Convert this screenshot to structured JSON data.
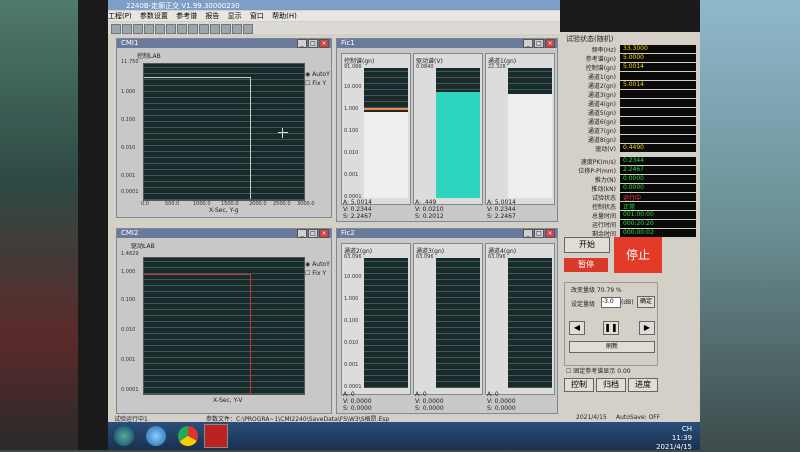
{
  "app": {
    "title": "2240B-走廊正交 V1.99.30000230"
  },
  "menu": [
    "工程(P)",
    "参数设置",
    "参考谱",
    "报告",
    "显示",
    "窗口",
    "帮助(H)"
  ],
  "cmi1": {
    "title": "CMI1",
    "plot_title": "控制LAB",
    "y_top": "11.750",
    "y_ticks": [
      "1.000",
      "0.100",
      "0.010",
      "0.001",
      "0.0001"
    ],
    "x_ticks": [
      "0.0",
      "500.0",
      "1000.0",
      "1500.0",
      "2000.0",
      "2500.0",
      "3000.0"
    ],
    "xlabel": "X-Sec, Y-g",
    "auto": "AutoY",
    "fix": "Fix Y"
  },
  "cmi2": {
    "title": "CMI2",
    "plot_title": "驱动LAB",
    "y_top": "1.4829",
    "y_ticks": [
      "1.000",
      "0.100",
      "0.010",
      "0.001",
      "0.0001"
    ],
    "x_ticks": [
      "0.0",
      "500.0",
      "1000.0",
      "1500.0",
      "2000.0",
      "2500.0",
      "3000.0"
    ],
    "xlabel": "X-Sec, Y-V",
    "auto": "AutoY",
    "fix": "Fix Y"
  },
  "fic1": {
    "title": "Fic1",
    "panels": [
      {
        "label": "控制谱(gn)",
        "top": "91.086",
        "ticks": [
          "10.000",
          "1.000",
          "0.100",
          "0.010",
          "0.001",
          "0.0001"
        ],
        "readout": [
          "A: 5.0014",
          "V: 0.2344",
          "S: 2.2467"
        ]
      },
      {
        "label": "驱动谱(V)",
        "top": "0.0840",
        "ticks": [
          "",
          "",
          "",
          "",
          "",
          ""
        ],
        "readout": [
          "A: .449",
          "V: 0.0210",
          "S: 0.2012"
        ]
      },
      {
        "label": "通道1(gn)",
        "top": "22.328",
        "ticks": [
          "",
          "",
          "",
          "",
          "",
          ""
        ],
        "readout": [
          "A: 5.0014",
          "V: 0.2344",
          "S: 2.2467"
        ]
      }
    ]
  },
  "fic2": {
    "title": "Fic2",
    "panels": [
      {
        "label": "通道2(gn)",
        "top": "63.096",
        "ticks": [
          "10.000",
          "1.000",
          "0.100",
          "0.010",
          "0.001",
          "0.0001"
        ],
        "readout": [
          "A: 0",
          "V: 0.0000",
          "S: 0.0000"
        ]
      },
      {
        "label": "通道3(gn)",
        "top": "63.096",
        "ticks": [
          "",
          "",
          "",
          "",
          "",
          ""
        ],
        "readout": [
          "A: 0",
          "V: 0.0000",
          "S: 0.0000"
        ]
      },
      {
        "label": "通道4(gn)",
        "top": "63.096",
        "ticks": [
          "",
          "",
          "",
          "",
          "",
          ""
        ],
        "readout": [
          "A: 0",
          "V: 0.0000",
          "S: 0.0000"
        ]
      }
    ]
  },
  "status_panel": {
    "title": "试验状态(随机)",
    "rows": [
      {
        "label": "频率(Hz)",
        "value": "33.3000"
      },
      {
        "label": "参考谱(gn)",
        "value": "5.0000"
      },
      {
        "label": "控制谱(gn)",
        "value": "5.0014"
      },
      {
        "label": "通道1(gn)",
        "value": ""
      },
      {
        "label": "通道2(gn)",
        "value": "5.0014"
      },
      {
        "label": "通道3(gn)",
        "value": ""
      },
      {
        "label": "通道4(gn)",
        "value": ""
      },
      {
        "label": "通道5(gn)",
        "value": ""
      },
      {
        "label": "通道6(gn)",
        "value": ""
      },
      {
        "label": "通道7(gn)",
        "value": ""
      },
      {
        "label": "通道8(gn)",
        "value": ""
      },
      {
        "label": "驱动(V)",
        "value": "0.4490"
      }
    ],
    "rows2": [
      {
        "label": "速度PK(m/s)",
        "value": "0.2344"
      },
      {
        "label": "位移P-P(mm)",
        "value": "2.2467"
      },
      {
        "label": "推力(N)",
        "value": "0.0000"
      },
      {
        "label": "推动(kN)",
        "value": "0.0000"
      },
      {
        "label": "试验状态",
        "value": "运行中"
      },
      {
        "label": "控制状态",
        "value": "正常"
      },
      {
        "label": "总量时间",
        "value": "001:00:00"
      },
      {
        "label": "运行时间",
        "value": "000:20:20"
      },
      {
        "label": "剩余时间",
        "value": "000:00:02"
      }
    ],
    "start": "开始",
    "stop": "停止",
    "pause": "暂停",
    "level_label": "改变量级",
    "level_value": "70.79 %",
    "set_level": "设定量级",
    "db_value": "-3.0",
    "db_unit": "(dB)",
    "confirm": "确定",
    "refresh": "刷新",
    "check_label": "固定参考谱显示",
    "check_value": "0.00",
    "tabs": [
      "控制",
      "归档",
      "进度"
    ]
  },
  "statusbar": {
    "left": "试验运行中1",
    "file": "参数文件：C:\\PROGRA~1\\CMI2240\\SaveData\\FS\\W3\\S格昂.Esp",
    "date": "2021/4/15",
    "autosave": "AutoSave: OFF"
  },
  "taskbar": {
    "time": "11:39",
    "date": "2021/4/15",
    "tray_text": "CH"
  }
}
